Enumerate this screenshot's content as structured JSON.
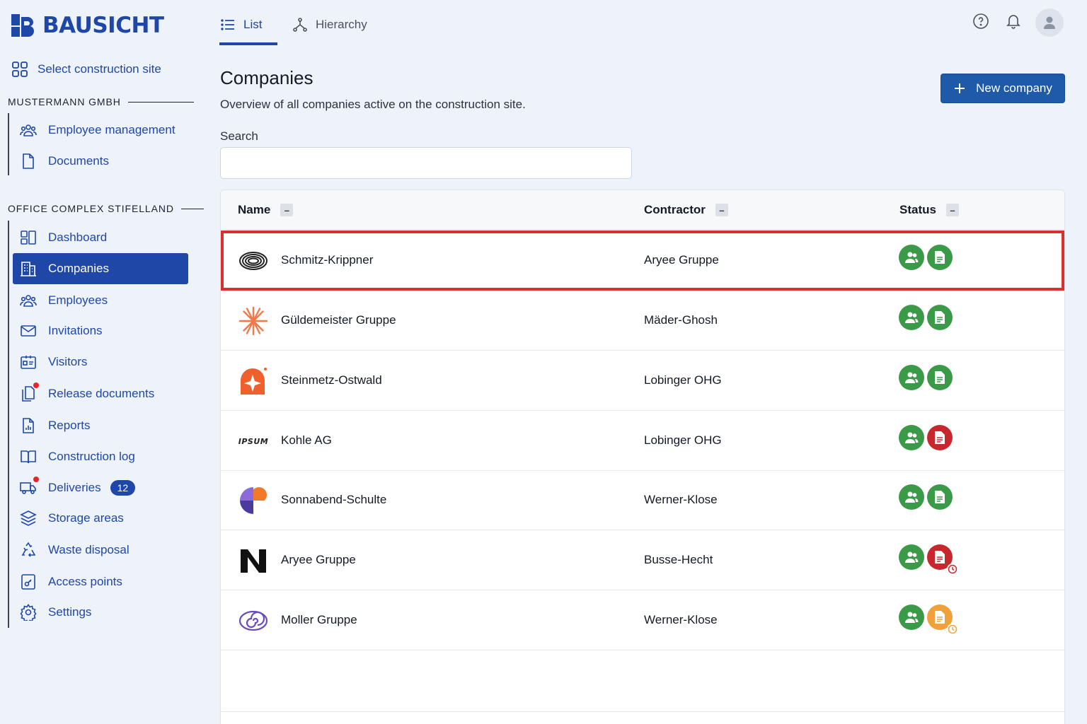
{
  "brand": {
    "name": "BAUSICHT"
  },
  "sidebar": {
    "select_site": "Select construction site",
    "sections": [
      {
        "title": "MUSTERMANN GMBH"
      },
      {
        "title": "OFFICE COMPLEX STIFELLAND"
      }
    ],
    "company_items": [
      {
        "label": "Employee management",
        "icon": "users-icon"
      },
      {
        "label": "Documents",
        "icon": "document-icon"
      }
    ],
    "site_items": [
      {
        "label": "Dashboard",
        "icon": "dashboard-icon"
      },
      {
        "label": "Companies",
        "icon": "building-icon",
        "active": true
      },
      {
        "label": "Employees",
        "icon": "users-icon"
      },
      {
        "label": "Invitations",
        "icon": "mail-icon"
      },
      {
        "label": "Visitors",
        "icon": "id-card-icon"
      },
      {
        "label": "Release documents",
        "icon": "documents-icon",
        "notification_dot": true
      },
      {
        "label": "Reports",
        "icon": "report-icon"
      },
      {
        "label": "Construction log",
        "icon": "book-icon"
      },
      {
        "label": "Deliveries",
        "icon": "truck-icon",
        "notification_dot": true,
        "badge": "12"
      },
      {
        "label": "Storage areas",
        "icon": "layers-icon"
      },
      {
        "label": "Waste disposal",
        "icon": "recycle-icon"
      },
      {
        "label": "Access points",
        "icon": "key-card-icon"
      },
      {
        "label": "Settings",
        "icon": "gear-icon"
      }
    ]
  },
  "topbar": {
    "tabs": [
      {
        "label": "List",
        "icon": "list-icon",
        "active": true
      },
      {
        "label": "Hierarchy",
        "icon": "hierarchy-icon"
      }
    ],
    "icons": [
      "help-icon",
      "bell-icon",
      "avatar-icon"
    ]
  },
  "main": {
    "title": "Companies",
    "subtitle": "Overview of all companies active on the construction site.",
    "new_button": "New company",
    "search": {
      "label": "Search",
      "value": "",
      "placeholder": ""
    },
    "table": {
      "columns": [
        {
          "label": "Name",
          "sort_symbol": "–"
        },
        {
          "label": "Contractor",
          "sort_symbol": "–"
        },
        {
          "label": "Status",
          "sort_symbol": "–"
        }
      ],
      "rows": [
        {
          "name": "Schmitz-Krippner",
          "contractor": "Aryee Gruppe",
          "logo": "rings-logo",
          "employees_status": "ok",
          "documents_status": "ok",
          "highlighted": true
        },
        {
          "name": "Güldemeister Gruppe",
          "contractor": "Mäder-Ghosh",
          "logo": "starburst-logo",
          "employees_status": "ok",
          "documents_status": "ok"
        },
        {
          "name": "Steinmetz-Ostwald",
          "contractor": "Lobinger OHG",
          "logo": "orange-spark-logo",
          "employees_status": "ok",
          "documents_status": "ok"
        },
        {
          "name": "Kohle AG",
          "contractor": "Lobinger OHG",
          "logo": "ipsum-wordmark-logo",
          "logo_text": "IPSUM",
          "employees_status": "ok",
          "documents_status": "error"
        },
        {
          "name": "Sonnabend-Schulte",
          "contractor": "Werner-Klose",
          "logo": "circles-logo",
          "employees_status": "ok",
          "documents_status": "ok"
        },
        {
          "name": "Aryee Gruppe",
          "contractor": "Busse-Hecht",
          "logo": "n-logo",
          "employees_status": "ok",
          "documents_status": "error-pending"
        },
        {
          "name": "Moller Gruppe",
          "contractor": "Werner-Klose",
          "logo": "spiral-logo",
          "employees_status": "ok",
          "documents_status": "warning-pending"
        }
      ]
    }
  },
  "colors": {
    "primary": "#1f47a8",
    "status_ok": "#3a9a48",
    "status_error": "#c8282d",
    "status_warning": "#f0a13a",
    "highlight": "#d9302c"
  }
}
